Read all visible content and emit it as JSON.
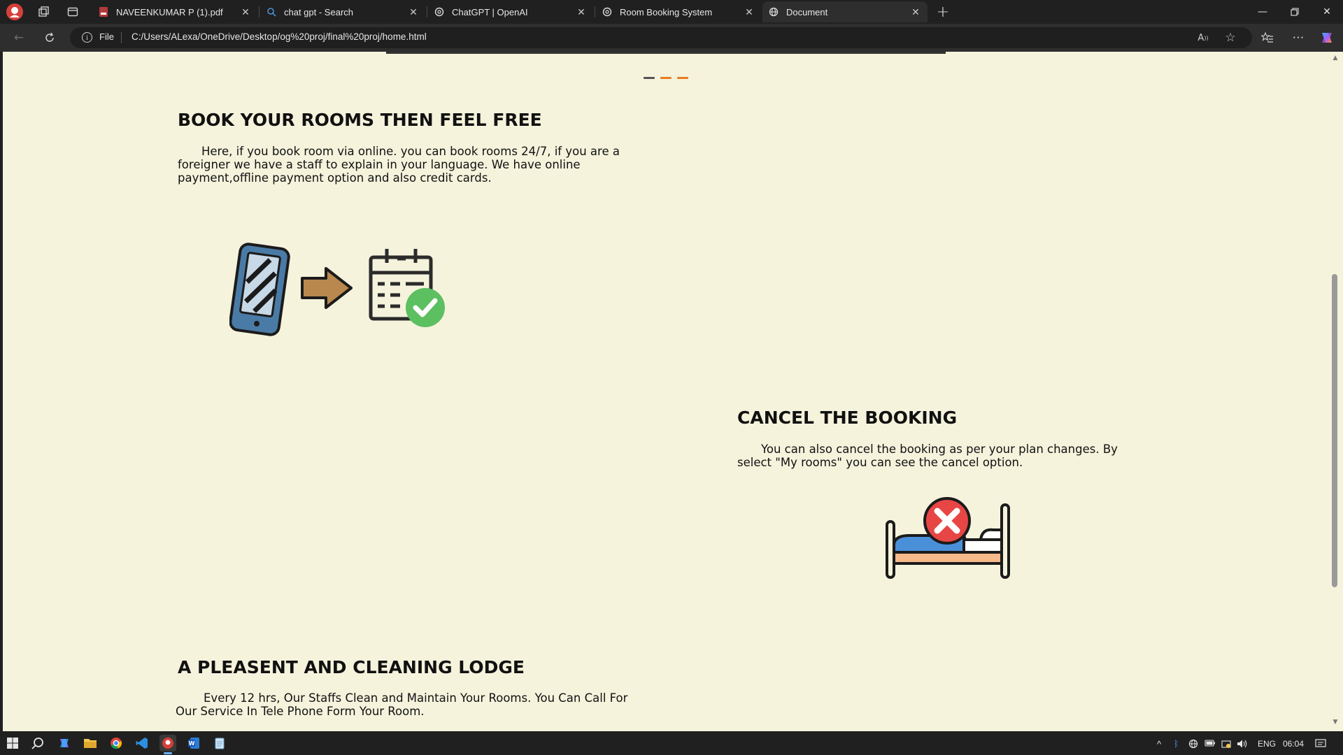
{
  "browser": {
    "tabs": [
      {
        "title": "NAVEENKUMAR P (1).pdf",
        "icon": "pdf-icon",
        "active": false
      },
      {
        "title": "chat gpt - Search",
        "icon": "search-icon",
        "active": false
      },
      {
        "title": "ChatGPT | OpenAI",
        "icon": "openai-icon",
        "active": false
      },
      {
        "title": "Room Booking System",
        "icon": "openai-icon",
        "active": false
      },
      {
        "title": "Document",
        "icon": "globe-icon",
        "active": true
      }
    ],
    "address": {
      "scheme_label": "File",
      "url": "C:/Users/ALexa/OneDrive/Desktop/og%20proj/final%20proj/home.html"
    }
  },
  "page": {
    "slider_dashes": [
      {
        "color": "#555555"
      },
      {
        "color": "#e67e22"
      },
      {
        "color": "#e67e22"
      }
    ],
    "sections": [
      {
        "title": "BOOK YOUR ROOMS THEN FEEL FREE",
        "text": "Here, if you book room via online. you can book rooms 24/7, if you are a foreigner we have a staff to explain in your language. We have online payment,offline payment option and also credit cards.",
        "image": "online-booking-illustration"
      },
      {
        "title": "CANCEL THE BOOKING",
        "text": "You can also cancel the booking as per your plan changes. By select \"My rooms\" you can see the cancel option.",
        "image": "cancel-bed-illustration"
      },
      {
        "title": "A PLEASENT AND CLEANING LODGE",
        "text": "Every 12 hrs, Our Staffs Clean and Maintain Your Rooms. You Can Call For Our Service In Tele Phone Form Your Room."
      }
    ]
  },
  "taskbar": {
    "language": "ENG",
    "time": "06:04"
  },
  "colors": {
    "page_background": "#f5f3dc",
    "accent": "#e67e22",
    "check_green": "#5cbf60",
    "cancel_red": "#e84545"
  }
}
